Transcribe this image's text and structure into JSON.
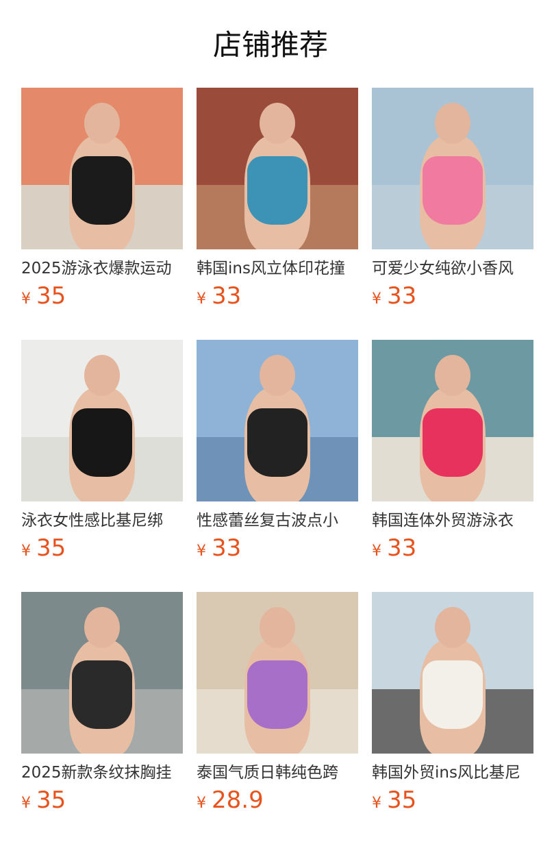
{
  "section": {
    "title": "店铺推荐"
  },
  "products": [
    {
      "name": "2025游泳衣爆款运动",
      "currency": "¥",
      "price": "35",
      "image": "black-swimsuit-photo",
      "colors": {
        "bg_top": "#e48a6a",
        "bg_bottom": "#d9cfc3",
        "suit": "#1b1b1b"
      }
    },
    {
      "name": "韩国ins风立体印花撞",
      "currency": "¥",
      "price": "33",
      "image": "blue-swimsuit-photo",
      "colors": {
        "bg_top": "#9b4b3a",
        "bg_bottom": "#b57a5c",
        "suit": "#3d93b5"
      }
    },
    {
      "name": "可爱少女纯欲小香风",
      "currency": "¥",
      "price": "33",
      "image": "pink-swimsuit-photo",
      "colors": {
        "bg_top": "#a9c3d4",
        "bg_bottom": "#b9ccd8",
        "suit": "#f07aa0"
      }
    },
    {
      "name": "泳衣女性感比基尼绑",
      "currency": "¥",
      "price": "35",
      "image": "two-bikini-selfie-photo",
      "colors": {
        "bg_top": "#ececea",
        "bg_bottom": "#deded9",
        "suit": "#171717"
      }
    },
    {
      "name": "性感蕾丝复古波点小",
      "currency": "¥",
      "price": "33",
      "image": "polka-dot-bikini-photo",
      "colors": {
        "bg_top": "#8fb3d6",
        "bg_bottom": "#6f93b8",
        "suit": "#222222"
      }
    },
    {
      "name": "韩国连体外贸游泳衣",
      "currency": "¥",
      "price": "33",
      "image": "red-swimsuit-photo",
      "colors": {
        "bg_top": "#6d9aa2",
        "bg_bottom": "#e2ddd2",
        "suit": "#e8325e"
      }
    },
    {
      "name": "2025新款条纹抹胸挂",
      "currency": "¥",
      "price": "35",
      "image": "striped-bikini-pool-photo",
      "colors": {
        "bg_top": "#7c8a8c",
        "bg_bottom": "#a5a9a7",
        "suit": "#2a2a2a"
      }
    },
    {
      "name": "泰国气质日韩纯色跨",
      "currency": "¥",
      "price": "28.9",
      "image": "purple-bikini-beach-photo",
      "colors": {
        "bg_top": "#d9c9b3",
        "bg_bottom": "#e6dccd",
        "suit": "#a86fc9"
      }
    },
    {
      "name": "韩国外贸ins风比基尼",
      "currency": "¥",
      "price": "35",
      "image": "street-bikini-photo",
      "colors": {
        "bg_top": "#c8d6e0",
        "bg_bottom": "#6b6b6b",
        "suit": "#f3f0ea"
      }
    }
  ]
}
